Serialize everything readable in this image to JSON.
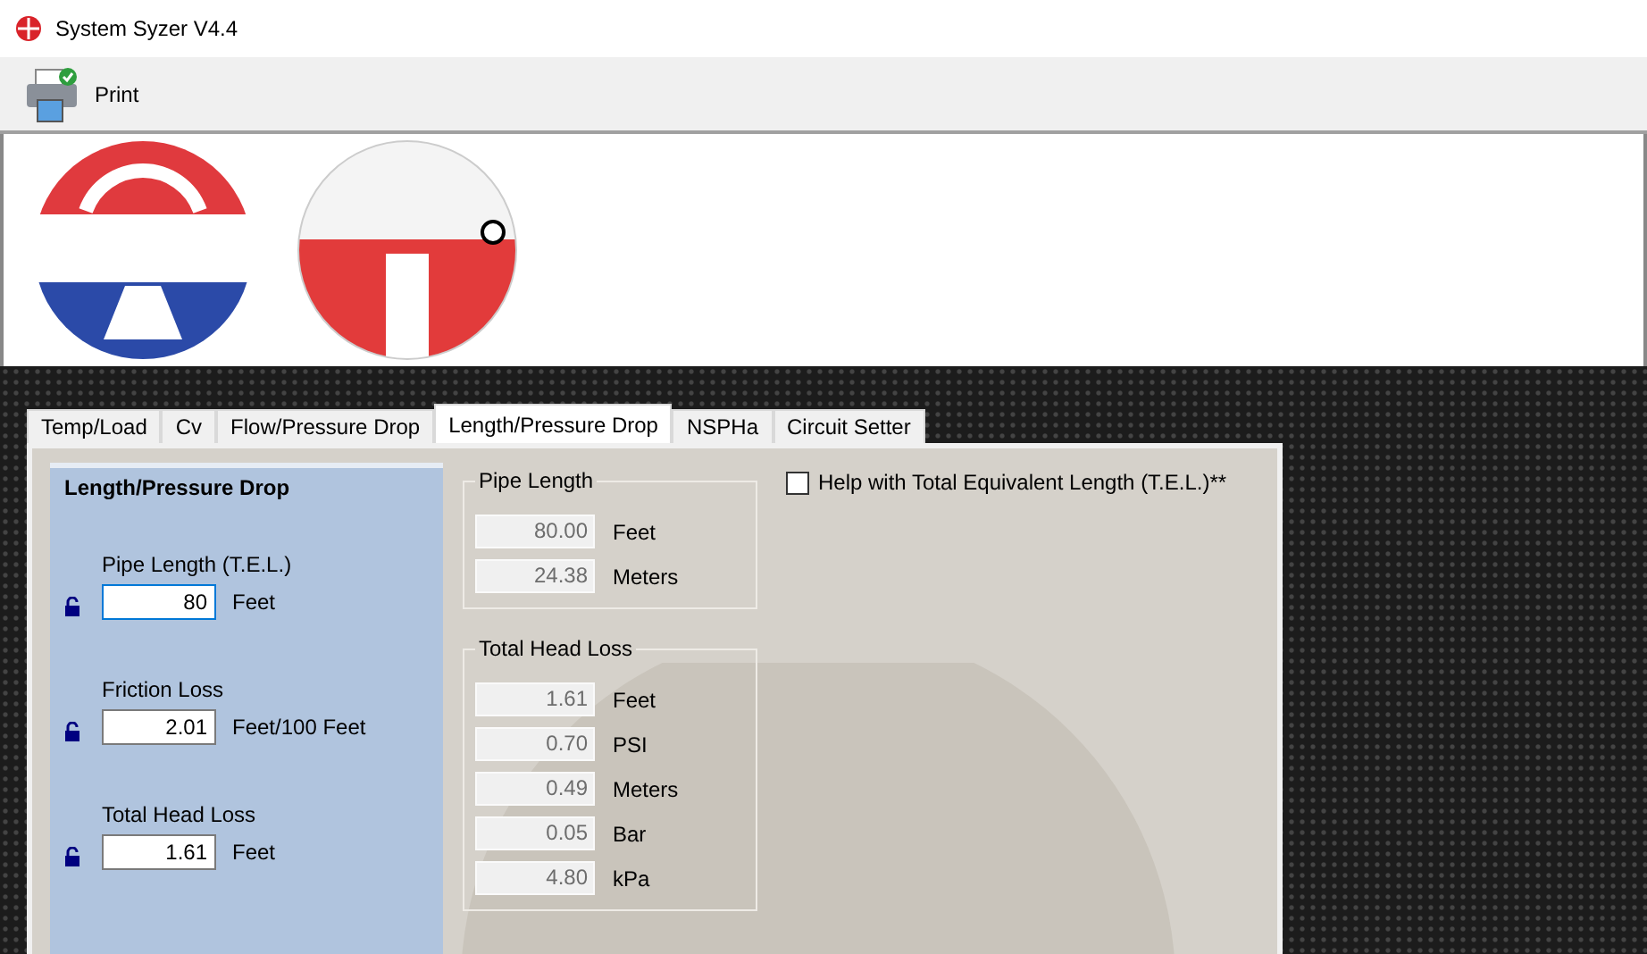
{
  "window": {
    "title": "System Syzer V4.4"
  },
  "toolbar": [
    {
      "label": "Print"
    }
  ],
  "tabs": [
    {
      "label": "Temp/Load",
      "selected": false
    },
    {
      "label": "Cv",
      "selected": false
    },
    {
      "label": "Flow/Pressure Drop",
      "selected": false
    },
    {
      "label": "Length/Pressure Drop",
      "selected": true
    },
    {
      "label": "NSPHa",
      "selected": false
    },
    {
      "label": "Circuit Setter",
      "selected": false
    }
  ],
  "input_group": {
    "title": "Length/Pressure Drop",
    "fields": [
      {
        "label": "Pipe Length (T.E.L.)",
        "value": "80",
        "unit": "Feet",
        "locked": false,
        "focused": true
      },
      {
        "label": "Friction Loss",
        "value": "2.01",
        "unit": "Feet/100 Feet",
        "locked": false,
        "focused": false
      },
      {
        "label": "Total Head Loss",
        "value": "1.61",
        "unit": "Feet",
        "locked": false,
        "focused": false
      }
    ]
  },
  "pipe_length": {
    "title": "Pipe Length",
    "rows": [
      {
        "value": "80.00",
        "unit": "Feet",
        "disabled": true
      },
      {
        "value": "24.38",
        "unit": "Meters",
        "disabled": true
      }
    ]
  },
  "total_head_loss": {
    "title": "Total Head Loss",
    "rows": [
      {
        "value": "1.61",
        "unit": "Feet",
        "disabled": true
      },
      {
        "value": "0.70",
        "unit": "PSI",
        "disabled": true
      },
      {
        "value": "0.49",
        "unit": "Meters",
        "disabled": true
      },
      {
        "value": "0.05",
        "unit": "Bar",
        "disabled": true
      },
      {
        "value": "4.80",
        "unit": "kPa",
        "disabled": true
      }
    ]
  },
  "help_checkbox": {
    "label": "Help with Total Equivalent Length (T.E.L.)**",
    "checked": false
  }
}
